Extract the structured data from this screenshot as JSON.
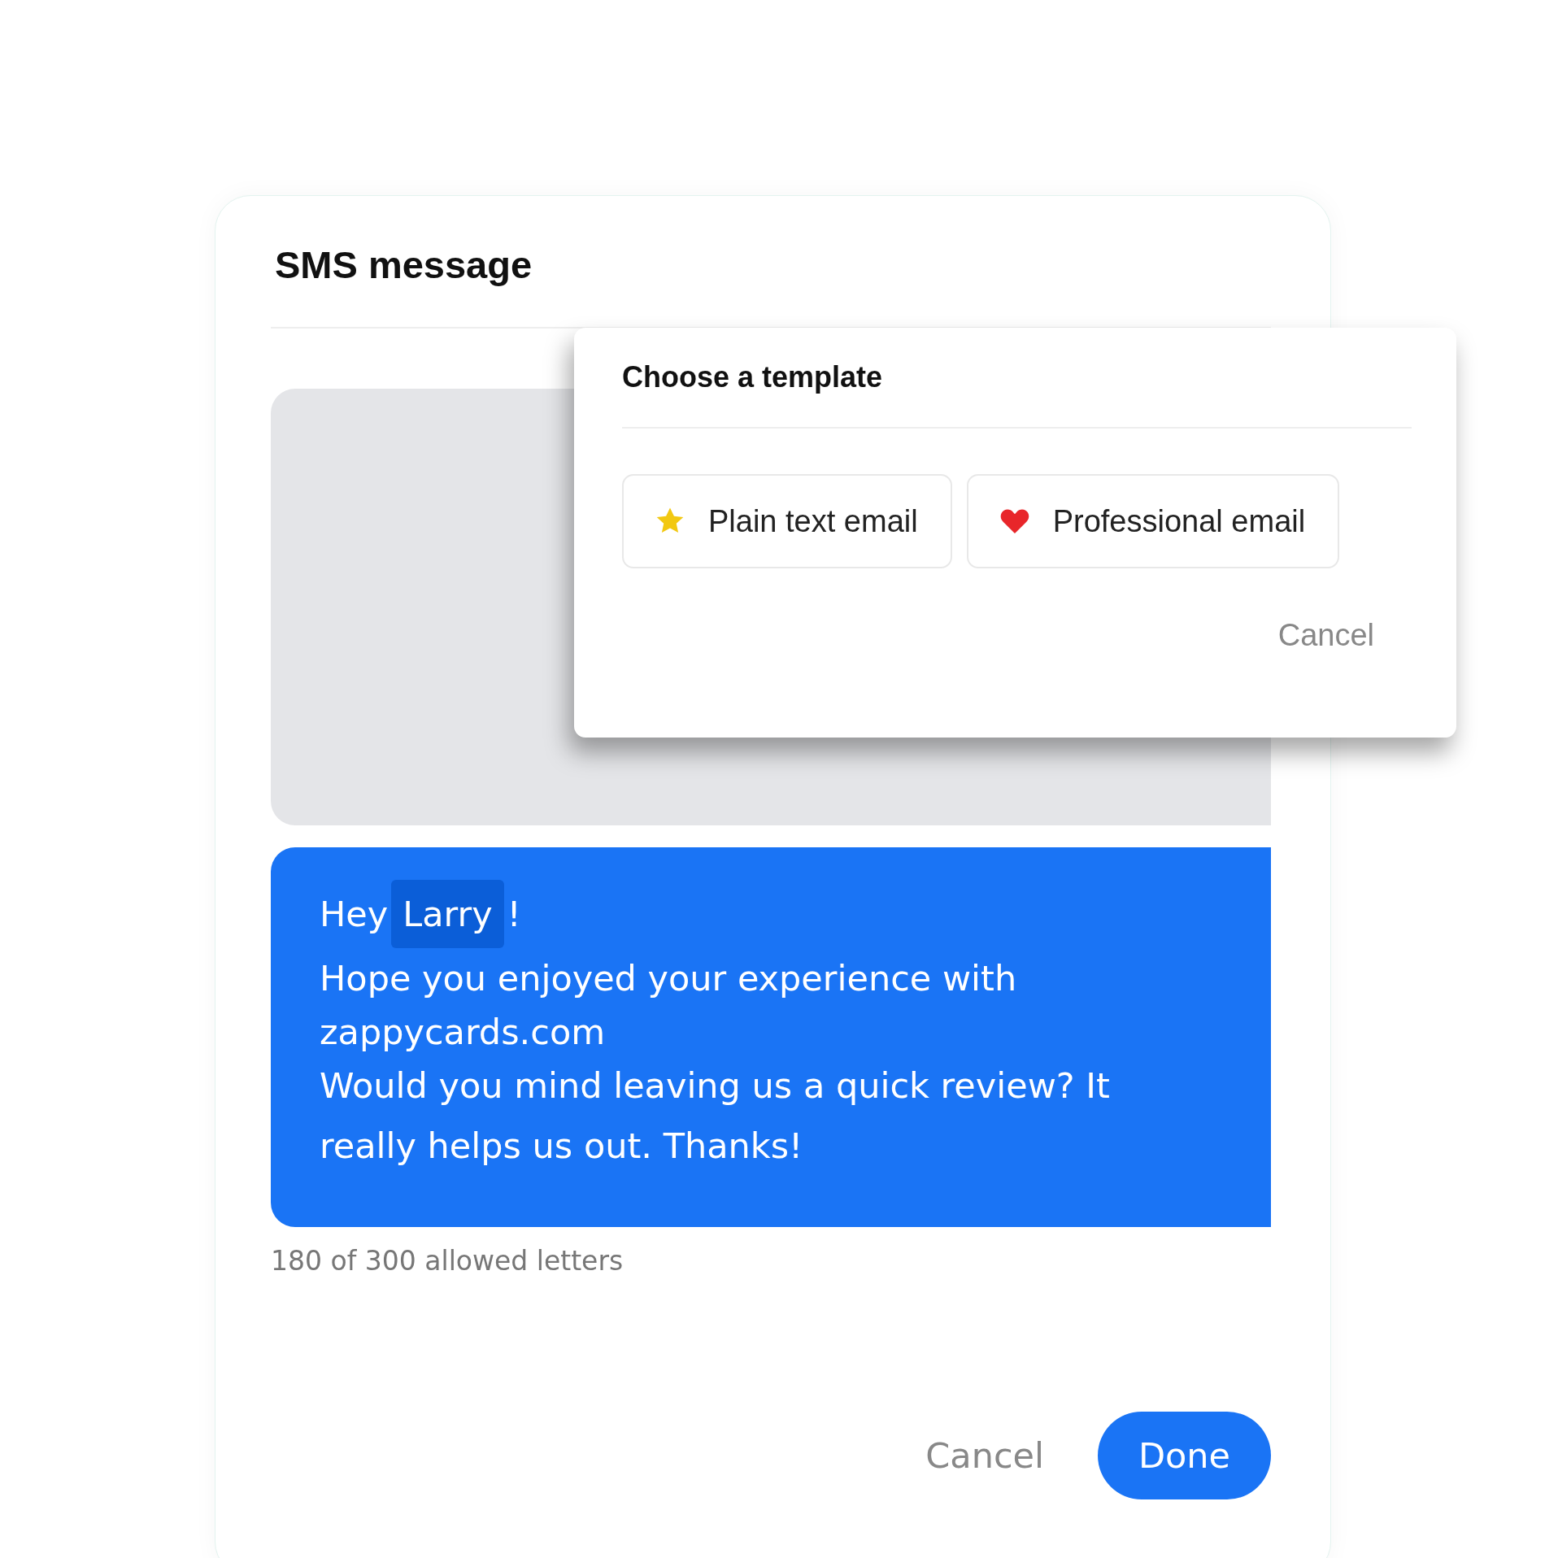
{
  "dialog": {
    "title": "SMS message"
  },
  "message": {
    "greeting": "Hey",
    "name_token": "Larry",
    "greeting_end": "!",
    "lines": [
      "Hope you enjoyed your experience with",
      "zappycards.com",
      "Would you mind leaving us a quick review? It really helps us out. Thanks!"
    ]
  },
  "counter": "180 of 300 allowed letters",
  "buttons": [
    {
      "label": "Cancel",
      "kind": "text"
    },
    {
      "label": "Done",
      "kind": "primary"
    }
  ],
  "template_popup": {
    "title": "Choose a template",
    "templates": [
      {
        "label": "Plain text email",
        "kind": "star"
      },
      {
        "label": "Professional email",
        "kind": "heart"
      }
    ],
    "cancel": "Cancel"
  }
}
